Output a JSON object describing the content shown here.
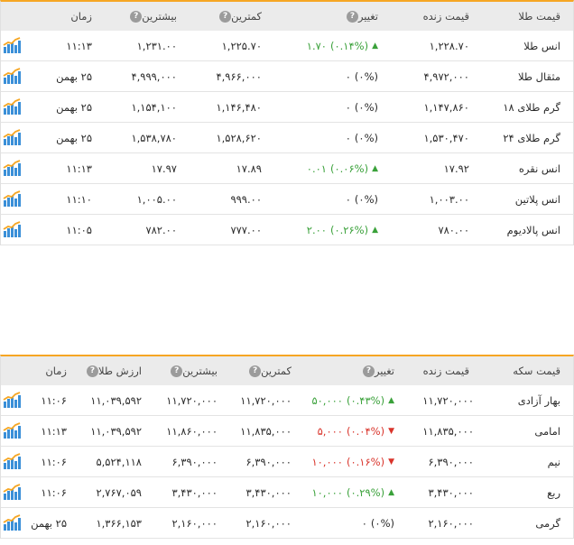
{
  "gold_table": {
    "headers": {
      "name": "قیمت طلا",
      "price": "قیمت زنده",
      "change": "تغییر",
      "low": "کمترین",
      "high": "بیشترین",
      "time": "زمان"
    },
    "rows": [
      {
        "name": "انس طلا",
        "price": "۱,۲۲۸.۷۰",
        "change_abs": "۱.۷۰",
        "change_pct": "(۰.۱۴%)",
        "direction": "up",
        "low": "۱,۲۲۵.۷۰",
        "high": "۱,۲۳۱.۰۰",
        "time": "۱۱:۱۳"
      },
      {
        "name": "مثقال طلا",
        "price": "۴,۹۷۲,۰۰۰",
        "change_abs": "۰",
        "change_pct": "(۰%)",
        "direction": "none",
        "low": "۴,۹۶۶,۰۰۰",
        "high": "۴,۹۹۹,۰۰۰",
        "time": "۲۵ بهمن"
      },
      {
        "name": "گرم طلای ۱۸",
        "price": "۱,۱۴۷,۸۶۰",
        "change_abs": "۰",
        "change_pct": "(۰%)",
        "direction": "none",
        "low": "۱,۱۴۶,۴۸۰",
        "high": "۱,۱۵۴,۱۰۰",
        "time": "۲۵ بهمن"
      },
      {
        "name": "گرم طلای ۲۴",
        "price": "۱,۵۳۰,۴۷۰",
        "change_abs": "۰",
        "change_pct": "(۰%)",
        "direction": "none",
        "low": "۱,۵۲۸,۶۲۰",
        "high": "۱,۵۳۸,۷۸۰",
        "time": "۲۵ بهمن"
      },
      {
        "name": "انس نقره",
        "price": "۱۷.۹۲",
        "change_abs": "۰.۰۱",
        "change_pct": "(۰.۰۶%)",
        "direction": "up",
        "low": "۱۷.۸۹",
        "high": "۱۷.۹۷",
        "time": "۱۱:۱۳"
      },
      {
        "name": "انس پلاتین",
        "price": "۱,۰۰۳.۰۰",
        "change_abs": "۰",
        "change_pct": "(۰%)",
        "direction": "none",
        "low": "۹۹۹.۰۰",
        "high": "۱,۰۰۵.۰۰",
        "time": "۱۱:۱۰"
      },
      {
        "name": "انس پالادیوم",
        "price": "۷۸۰.۰۰",
        "change_abs": "۲.۰۰",
        "change_pct": "(۰.۲۶%)",
        "direction": "up",
        "low": "۷۷۷.۰۰",
        "high": "۷۸۲.۰۰",
        "time": "۱۱:۰۵"
      }
    ]
  },
  "coin_table": {
    "headers": {
      "name": "قیمت سکه",
      "price": "قیمت زنده",
      "change": "تغییر",
      "low": "کمترین",
      "high": "بیشترین",
      "gold_value": "ارزش طلا",
      "time": "زمان"
    },
    "rows": [
      {
        "name": "بهار آزادی",
        "price": "۱۱,۷۲۰,۰۰۰",
        "change_abs": "۵۰,۰۰۰",
        "change_pct": "(۰.۴۳%)",
        "direction": "up",
        "low": "۱۱,۷۲۰,۰۰۰",
        "high": "۱۱,۷۲۰,۰۰۰",
        "gold_value": "۱۱,۰۳۹,۵۹۲",
        "time": "۱۱:۰۶"
      },
      {
        "name": "امامی",
        "price": "۱۱,۸۳۵,۰۰۰",
        "change_abs": "۵,۰۰۰",
        "change_pct": "(۰.۰۴%)",
        "direction": "down",
        "low": "۱۱,۸۳۵,۰۰۰",
        "high": "۱۱,۸۶۰,۰۰۰",
        "gold_value": "۱۱,۰۳۹,۵۹۲",
        "time": "۱۱:۱۳"
      },
      {
        "name": "نیم",
        "price": "۶,۳۹۰,۰۰۰",
        "change_abs": "۱۰,۰۰۰",
        "change_pct": "(۰.۱۶%)",
        "direction": "down",
        "low": "۶,۳۹۰,۰۰۰",
        "high": "۶,۳۹۰,۰۰۰",
        "gold_value": "۵,۵۲۴,۱۱۸",
        "time": "۱۱:۰۶"
      },
      {
        "name": "ربع",
        "price": "۳,۴۳۰,۰۰۰",
        "change_abs": "۱۰,۰۰۰",
        "change_pct": "(۰.۲۹%)",
        "direction": "up",
        "low": "۳,۴۳۰,۰۰۰",
        "high": "۳,۴۳۰,۰۰۰",
        "gold_value": "۲,۷۶۷,۰۵۹",
        "time": "۱۱:۰۶"
      },
      {
        "name": "گرمی",
        "price": "۲,۱۶۰,۰۰۰",
        "change_abs": "۰",
        "change_pct": "(۰%)",
        "direction": "none",
        "low": "۲,۱۶۰,۰۰۰",
        "high": "۲,۱۶۰,۰۰۰",
        "gold_value": "۱,۳۶۶,۱۵۳",
        "time": "۲۵ بهمن"
      }
    ]
  },
  "icons": {
    "help": "question-circle-icon",
    "chart": "bar-chart-icon",
    "up": "triangle-up-icon",
    "down": "triangle-down-icon"
  },
  "colors": {
    "accent": "#f6a623",
    "positive": "#3aa13a",
    "negative": "#d9342b",
    "header_bg": "#ebebeb",
    "chart_blue": "#3a8fd8"
  }
}
